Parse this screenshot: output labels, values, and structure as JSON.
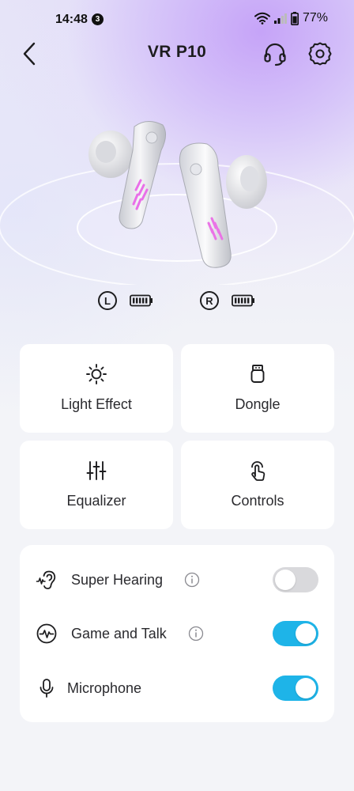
{
  "status_bar": {
    "time": "14:48",
    "notification_count": "3",
    "battery_percent": "77%"
  },
  "header": {
    "title": "VR P10"
  },
  "earbuds": {
    "left_label": "L",
    "right_label": "R",
    "left_battery_level": 1.0,
    "right_battery_level": 1.0
  },
  "features": [
    {
      "label": "Light Effect",
      "icon": "sun-icon"
    },
    {
      "label": "Dongle",
      "icon": "dongle-icon"
    },
    {
      "label": "Equalizer",
      "icon": "equalizer-icon"
    },
    {
      "label": "Controls",
      "icon": "touch-icon"
    }
  ],
  "settings": [
    {
      "label": "Super Hearing",
      "icon": "ear-icon",
      "has_info": true,
      "enabled": false
    },
    {
      "label": "Game and Talk",
      "icon": "pulse-icon",
      "has_info": true,
      "enabled": true
    },
    {
      "label": "Microphone",
      "icon": "microphone-icon",
      "has_info": false,
      "enabled": true
    }
  ],
  "colors": {
    "accent": "#1eb4e8",
    "toggle_off": "#d9d9dc",
    "background_gradient": "#c4a0f8"
  }
}
